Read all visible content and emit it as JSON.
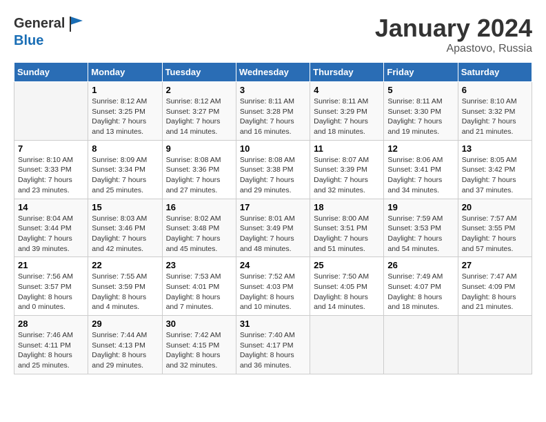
{
  "header": {
    "logo_line1": "General",
    "logo_line2": "Blue",
    "month": "January 2024",
    "location": "Apastovo, Russia"
  },
  "days_of_week": [
    "Sunday",
    "Monday",
    "Tuesday",
    "Wednesday",
    "Thursday",
    "Friday",
    "Saturday"
  ],
  "weeks": [
    [
      {
        "day": "",
        "info": ""
      },
      {
        "day": "1",
        "info": "Sunrise: 8:12 AM\nSunset: 3:25 PM\nDaylight: 7 hours\nand 13 minutes."
      },
      {
        "day": "2",
        "info": "Sunrise: 8:12 AM\nSunset: 3:27 PM\nDaylight: 7 hours\nand 14 minutes."
      },
      {
        "day": "3",
        "info": "Sunrise: 8:11 AM\nSunset: 3:28 PM\nDaylight: 7 hours\nand 16 minutes."
      },
      {
        "day": "4",
        "info": "Sunrise: 8:11 AM\nSunset: 3:29 PM\nDaylight: 7 hours\nand 18 minutes."
      },
      {
        "day": "5",
        "info": "Sunrise: 8:11 AM\nSunset: 3:30 PM\nDaylight: 7 hours\nand 19 minutes."
      },
      {
        "day": "6",
        "info": "Sunrise: 8:10 AM\nSunset: 3:32 PM\nDaylight: 7 hours\nand 21 minutes."
      }
    ],
    [
      {
        "day": "7",
        "info": "Sunrise: 8:10 AM\nSunset: 3:33 PM\nDaylight: 7 hours\nand 23 minutes."
      },
      {
        "day": "8",
        "info": "Sunrise: 8:09 AM\nSunset: 3:34 PM\nDaylight: 7 hours\nand 25 minutes."
      },
      {
        "day": "9",
        "info": "Sunrise: 8:08 AM\nSunset: 3:36 PM\nDaylight: 7 hours\nand 27 minutes."
      },
      {
        "day": "10",
        "info": "Sunrise: 8:08 AM\nSunset: 3:38 PM\nDaylight: 7 hours\nand 29 minutes."
      },
      {
        "day": "11",
        "info": "Sunrise: 8:07 AM\nSunset: 3:39 PM\nDaylight: 7 hours\nand 32 minutes."
      },
      {
        "day": "12",
        "info": "Sunrise: 8:06 AM\nSunset: 3:41 PM\nDaylight: 7 hours\nand 34 minutes."
      },
      {
        "day": "13",
        "info": "Sunrise: 8:05 AM\nSunset: 3:42 PM\nDaylight: 7 hours\nand 37 minutes."
      }
    ],
    [
      {
        "day": "14",
        "info": "Sunrise: 8:04 AM\nSunset: 3:44 PM\nDaylight: 7 hours\nand 39 minutes."
      },
      {
        "day": "15",
        "info": "Sunrise: 8:03 AM\nSunset: 3:46 PM\nDaylight: 7 hours\nand 42 minutes."
      },
      {
        "day": "16",
        "info": "Sunrise: 8:02 AM\nSunset: 3:48 PM\nDaylight: 7 hours\nand 45 minutes."
      },
      {
        "day": "17",
        "info": "Sunrise: 8:01 AM\nSunset: 3:49 PM\nDaylight: 7 hours\nand 48 minutes."
      },
      {
        "day": "18",
        "info": "Sunrise: 8:00 AM\nSunset: 3:51 PM\nDaylight: 7 hours\nand 51 minutes."
      },
      {
        "day": "19",
        "info": "Sunrise: 7:59 AM\nSunset: 3:53 PM\nDaylight: 7 hours\nand 54 minutes."
      },
      {
        "day": "20",
        "info": "Sunrise: 7:57 AM\nSunset: 3:55 PM\nDaylight: 7 hours\nand 57 minutes."
      }
    ],
    [
      {
        "day": "21",
        "info": "Sunrise: 7:56 AM\nSunset: 3:57 PM\nDaylight: 8 hours\nand 0 minutes."
      },
      {
        "day": "22",
        "info": "Sunrise: 7:55 AM\nSunset: 3:59 PM\nDaylight: 8 hours\nand 4 minutes."
      },
      {
        "day": "23",
        "info": "Sunrise: 7:53 AM\nSunset: 4:01 PM\nDaylight: 8 hours\nand 7 minutes."
      },
      {
        "day": "24",
        "info": "Sunrise: 7:52 AM\nSunset: 4:03 PM\nDaylight: 8 hours\nand 10 minutes."
      },
      {
        "day": "25",
        "info": "Sunrise: 7:50 AM\nSunset: 4:05 PM\nDaylight: 8 hours\nand 14 minutes."
      },
      {
        "day": "26",
        "info": "Sunrise: 7:49 AM\nSunset: 4:07 PM\nDaylight: 8 hours\nand 18 minutes."
      },
      {
        "day": "27",
        "info": "Sunrise: 7:47 AM\nSunset: 4:09 PM\nDaylight: 8 hours\nand 21 minutes."
      }
    ],
    [
      {
        "day": "28",
        "info": "Sunrise: 7:46 AM\nSunset: 4:11 PM\nDaylight: 8 hours\nand 25 minutes."
      },
      {
        "day": "29",
        "info": "Sunrise: 7:44 AM\nSunset: 4:13 PM\nDaylight: 8 hours\nand 29 minutes."
      },
      {
        "day": "30",
        "info": "Sunrise: 7:42 AM\nSunset: 4:15 PM\nDaylight: 8 hours\nand 32 minutes."
      },
      {
        "day": "31",
        "info": "Sunrise: 7:40 AM\nSunset: 4:17 PM\nDaylight: 8 hours\nand 36 minutes."
      },
      {
        "day": "",
        "info": ""
      },
      {
        "day": "",
        "info": ""
      },
      {
        "day": "",
        "info": ""
      }
    ]
  ]
}
